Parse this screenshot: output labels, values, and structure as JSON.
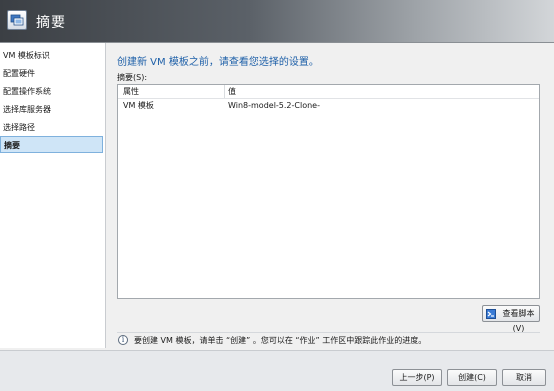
{
  "header": {
    "title": "摘要"
  },
  "sidebar": {
    "items": [
      {
        "label": "VM 模板标识",
        "selected": false
      },
      {
        "label": "配置硬件",
        "selected": false
      },
      {
        "label": "配置操作系统",
        "selected": false
      },
      {
        "label": "选择库服务器",
        "selected": false
      },
      {
        "label": "选择路径",
        "selected": false
      },
      {
        "label": "摘要",
        "selected": true
      }
    ]
  },
  "main": {
    "title": "创建新 VM 模板之前，请查看您选择的设置。",
    "summary_label": "摘要(S):",
    "table": {
      "columns": [
        "属性",
        "值"
      ],
      "rows": [
        {
          "property": "VM 模板",
          "value": "Win8-model-5.2-Clone-"
        }
      ]
    },
    "view_script_button": "查看脚本(V)",
    "info_text": "要创建 VM 模板，请单击 “创建” 。您可以在 “作业” 工作区中跟踪此作业的进度。"
  },
  "footer": {
    "back_label": "上一步(P)",
    "create_label": "创建(C)",
    "cancel_label": "取消"
  }
}
